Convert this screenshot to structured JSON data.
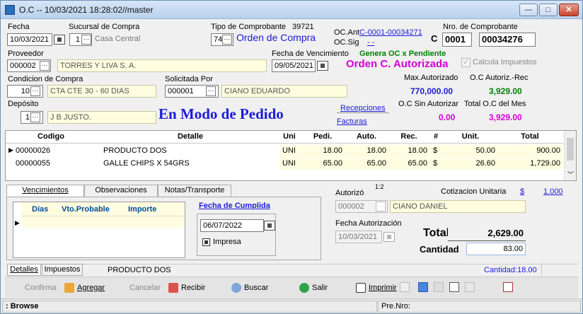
{
  "window": {
    "title": "O.C -- 10/03/2021 18:28:02//master",
    "min": "—",
    "max": "□",
    "close": "✕"
  },
  "header": {
    "fecha_label": "Fecha",
    "fecha": "10/03/2021",
    "sucursal_label": "Sucursal de Compra",
    "sucursal_code": "1",
    "sucursal_name": "Casa Central",
    "tipo_label": "Tipo de Comprobante",
    "tipo_num": "39721",
    "tipo_code": "74",
    "tipo_name": "Orden de Compra",
    "ocant_label": "OC.Ant",
    "ocant_value": "C-0001-00034271",
    "ocsig_label": "OC.Sig",
    "ocsig_value": "- -",
    "nro_label": "Nro. de Comprobante",
    "nro_letter": "C",
    "nro_pv": "0001",
    "nro_num": "00034276",
    "proveedor_label": "Proveedor",
    "proveedor_code": "000002",
    "proveedor_name": "TORRES Y LIVA S. A.",
    "venc_label": "Fecha de Vencimiento",
    "venc": "09/05/2021",
    "genera": "Genera OC x Pendiente",
    "autorizada": "Orden C. Autorizada",
    "calcula": "Calcula Impuestos",
    "condicion_label": "Condicion de Compra",
    "condicion_code": "10",
    "condicion_name": "CTA CTE 30 - 60 DIAS",
    "solicitada_label": "Solicitada Por",
    "solicitada_code": "000001",
    "solicitada_name": "CIANO EDUARDO",
    "maxaut_label": "Max.Autorizado",
    "maxaut": "770,000.00",
    "ocautrec_label": "O.C Autoriz.-Rec",
    "ocautrec": "3,929.00",
    "deposito_label": "Depósito",
    "deposito_code": "1",
    "deposito_name": "J B JUSTO.",
    "modo": "En Modo de Pedido",
    "recepciones": "Recepciones",
    "facturas": "Facturas",
    "sinaut_label": "O.C Sin Autorizar",
    "sinaut": "0.00",
    "totalmes_label": "Total O.C del  Mes",
    "totalmes": "3,929.00"
  },
  "grid": {
    "headers": [
      "Codigo",
      "Detalle",
      "Uni",
      "Pedi.",
      "Auto.",
      "Rec.",
      "#",
      "Unit.",
      "Total"
    ],
    "rows": [
      {
        "marker": "▶",
        "codigo": "00000026",
        "detalle": "PRODUCTO DOS",
        "uni": "UNI",
        "pedi": "18.00",
        "auto": "18.00",
        "rec": "18.00",
        "mon": "$",
        "unit": "50.00",
        "total": "900.00"
      },
      {
        "marker": "",
        "codigo": "00000055",
        "detalle": "GALLE CHIPS X 54GRS",
        "uni": "UNI",
        "pedi": "65.00",
        "auto": "65.00",
        "rec": "65.00",
        "mon": "$",
        "unit": "26.60",
        "total": "1,729.00"
      }
    ]
  },
  "tabs": [
    "Vencimientos",
    "Observaciones",
    "Notas/Transporte"
  ],
  "venc": {
    "headers": [
      "Días",
      "Vto.Probable",
      "Importe"
    ],
    "cumplida_label": "Fecha de Cumplida",
    "cumplida": "06/07/2022",
    "impresa": "Impresa"
  },
  "right": {
    "autorizo_label": "Autorizó",
    "autorizo_sup": "1:2",
    "autorizo_code": "000002",
    "autorizo_name": "CIANO DANIEL",
    "cotiz_label": "Cotizacion Unitaria",
    "cotiz_cur": "$",
    "cotiz_val": "1.000",
    "fechaaut_label": "Fecha Autorización",
    "fechaaut": "10/03/2021",
    "total_label": "Total",
    "total": "2,629.00",
    "cantidad_label": "Cantidad",
    "cantidad": "83.00"
  },
  "bottomtabs": {
    "detalles": "Detalles",
    "impuestos": "Impuestos",
    "producto": "PRODUCTO DOS",
    "cantidad": "Cantidad:18.00"
  },
  "toolbar": {
    "confirma": "Confirma",
    "agregar": "Agregar",
    "cancelar": "Cancelar",
    "recibir": "Recibir",
    "buscar": "Buscar",
    "salir": "Salir",
    "imprimir": "Imprimir"
  },
  "status": {
    "mode": ": Browse",
    "prenro": "Pre.Nro:"
  },
  "colors": {
    "accent": "#1b1bd9",
    "green": "#008000",
    "magenta": "#d400d4",
    "yellow_field": "#fffde0"
  }
}
